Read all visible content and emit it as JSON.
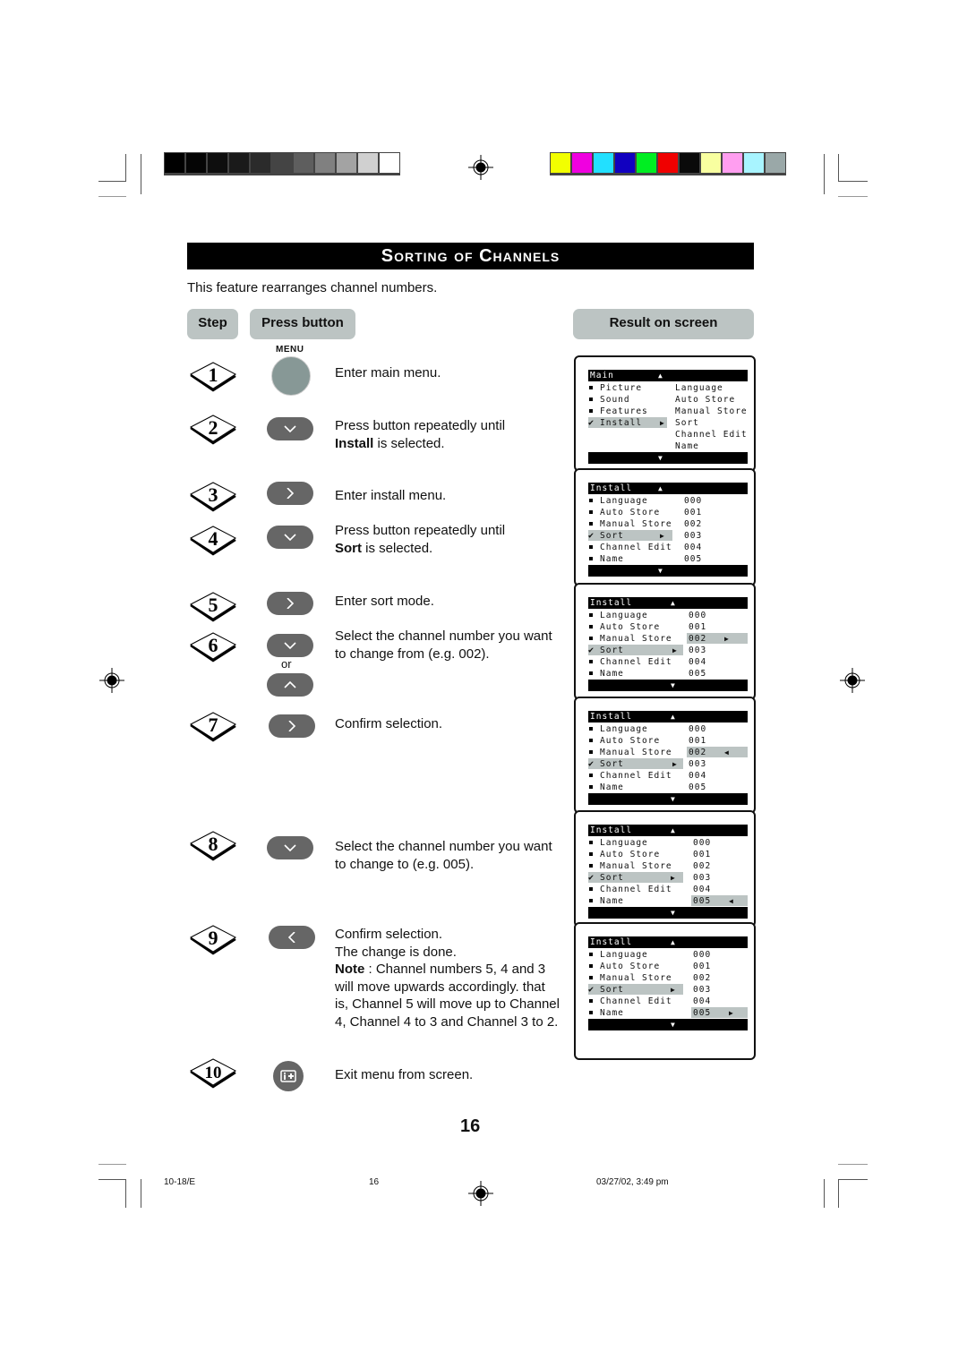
{
  "color_bars": {
    "grayscale": [
      "#000000",
      "#050505",
      "#0e0e0e",
      "#1a1a1a",
      "#2b2b2b",
      "#444444",
      "#5e5e5e",
      "#808080",
      "#a3a3a3",
      "#d0d0d0",
      "#ffffff"
    ],
    "colors": [
      "#f2ff00",
      "#f000e0",
      "#22e0ff",
      "#1100c0",
      "#00ee22",
      "#f00000",
      "#0a0a0a",
      "#f8ffa0",
      "#ff9ef0",
      "#a8f4ff",
      "#9aa8a8"
    ]
  },
  "title": "Sorting of Channels",
  "intro": "This feature rearranges channel numbers.",
  "headers": {
    "step": "Step",
    "press_button": "Press button",
    "result": "Result on screen"
  },
  "menu_label": "MENU",
  "or_label": "or",
  "steps": [
    {
      "num": "1",
      "button": "menu",
      "text": "Enter main menu."
    },
    {
      "num": "2",
      "button": "down",
      "text_pre": "Press button repeatedly until",
      "text_bold": "Install",
      "text_post": " is selected."
    },
    {
      "num": "3",
      "button": "right",
      "text": "Enter install menu."
    },
    {
      "num": "4",
      "button": "down",
      "text_pre": "Press button repeatedly until",
      "text_bold": "Sort",
      "text_post": " is selected."
    },
    {
      "num": "5",
      "button": "right",
      "text": "Enter sort mode."
    },
    {
      "num": "6",
      "button": "down/up",
      "line1": "Select the channel number you want",
      "line2": "to change from (e.g. 002)."
    },
    {
      "num": "7",
      "button": "right",
      "text": "Confirm selection."
    },
    {
      "num": "8",
      "button": "down",
      "line1": "Select the channel number you want",
      "line2": "to change to (e.g. 005)."
    },
    {
      "num": "9",
      "button": "left",
      "line1": "Confirm selection.",
      "line2": "The change is done.",
      "note_label": "Note",
      "note_lines": [
        " : Channel numbers 5, 4 and 3",
        "will move upwards accordingly. that",
        "is, Channel 5 will move up to Channel",
        "4, Channel 4 to 3 and Channel 3 to 2."
      ]
    },
    {
      "num": "10",
      "button": "info",
      "text": "Exit menu from screen."
    }
  ],
  "screens": {
    "main": {
      "title": "Main",
      "items": [
        "Picture",
        "Sound",
        "Features",
        "Install"
      ],
      "submenu": [
        "Language",
        "Auto Store",
        "Manual Store",
        "Sort",
        "Channel Edit",
        "Name"
      ]
    },
    "install": {
      "title": "Install",
      "items": [
        "Language",
        "Auto Store",
        "Manual Store",
        "Sort",
        "Channel Edit",
        "Name"
      ],
      "values": [
        "000",
        "001",
        "002",
        "003",
        "004",
        "005"
      ]
    }
  },
  "page_number": "16",
  "footer": {
    "left": "10-18/E",
    "center": "16",
    "right": "03/27/02, 3:49 pm"
  }
}
